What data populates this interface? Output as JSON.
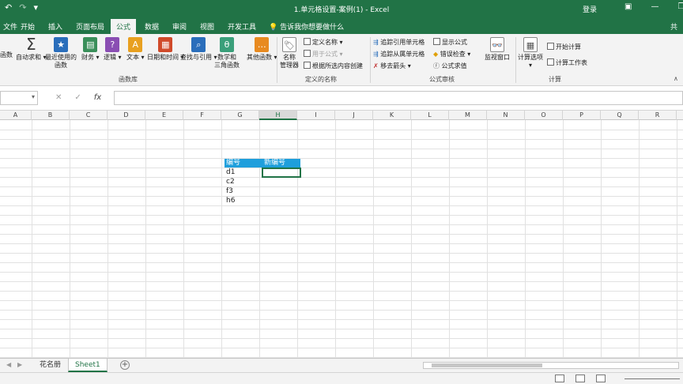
{
  "titlebar": {
    "undo_icon": "undo-icon",
    "redo_icon": "redo-icon",
    "customize_icon": "customize-qat-icon",
    "title": "1.单元格设置-案例(1)  -  Excel",
    "login": "登录",
    "restore_icon": "ribbon-display-icon",
    "minimize_glyph": "—",
    "maximize_glyph": "❐"
  },
  "tabs": [
    "文件",
    "开始",
    "插入",
    "页面布局",
    "公式",
    "数据",
    "审阅",
    "视图",
    "开发工具"
  ],
  "active_tab": "公式",
  "tell_me": "告诉我你想要做什么",
  "share": "共",
  "ribbon": {
    "function_library": {
      "group_label": "函数库",
      "partial_left": "函数",
      "buttons": [
        {
          "label": "自动求和",
          "icon": "Σ",
          "color": "#3b3b3b"
        },
        {
          "label": "最近使用的\n函数",
          "icon": "★",
          "color": "#2a6ebb"
        },
        {
          "label": "财务",
          "icon": "▤",
          "color": "#3a8f5a"
        },
        {
          "label": "逻辑",
          "icon": "?",
          "color": "#8a4eb3"
        },
        {
          "label": "文本",
          "icon": "A",
          "color": "#e8a020"
        },
        {
          "label": "日期和时间",
          "icon": "▦",
          "color": "#d04a2a"
        },
        {
          "label": "查找与引用",
          "icon": "⌕",
          "color": "#2a6ebb"
        },
        {
          "label": "数学和\n三角函数",
          "icon": "θ",
          "color": "#3a9f7a"
        },
        {
          "label": "其他函数",
          "icon": "…",
          "color": "#e88a20"
        }
      ]
    },
    "defined_names": {
      "group_label": "定义的名称",
      "name_manager": "名称\n管理器",
      "define_name": "定义名称",
      "use_in_formula": "用于公式",
      "create_from_selection": "根据所选内容创建"
    },
    "formula_auditing": {
      "group_label": "公式审核",
      "trace_precedents": "追踪引用单元格",
      "trace_dependents": "追踪从属单元格",
      "remove_arrows": "移去箭头",
      "show_formulas": "显示公式",
      "error_checking": "错误检查",
      "evaluate_formula": "公式求值",
      "watch_window": "监视窗口"
    },
    "calculation": {
      "group_label": "计算",
      "calc_options": "计算选项",
      "calc_now": "开始计算",
      "calc_sheet": "计算工作表"
    }
  },
  "formula_bar": {
    "name_box": "",
    "cancel_glyph": "✕",
    "enter_glyph": "✓",
    "fx": "fx",
    "formula": ""
  },
  "columns": [
    "A",
    "B",
    "C",
    "D",
    "E",
    "F",
    "G",
    "H",
    "I",
    "J",
    "K",
    "L",
    "M",
    "N",
    "O",
    "P",
    "Q",
    "R"
  ],
  "selected_column": "H",
  "cells": {
    "G1": "编号",
    "H1": "新编号",
    "G2": "d1",
    "G3": "c2",
    "G4": "f3",
    "G5": "h6"
  },
  "sheets": [
    "花名册",
    "Sheet1"
  ],
  "active_sheet": "Sheet1",
  "add_sheet_glyph": "+",
  "colors": {
    "excel_green": "#217346",
    "header_fill": "#1e9fdc"
  }
}
